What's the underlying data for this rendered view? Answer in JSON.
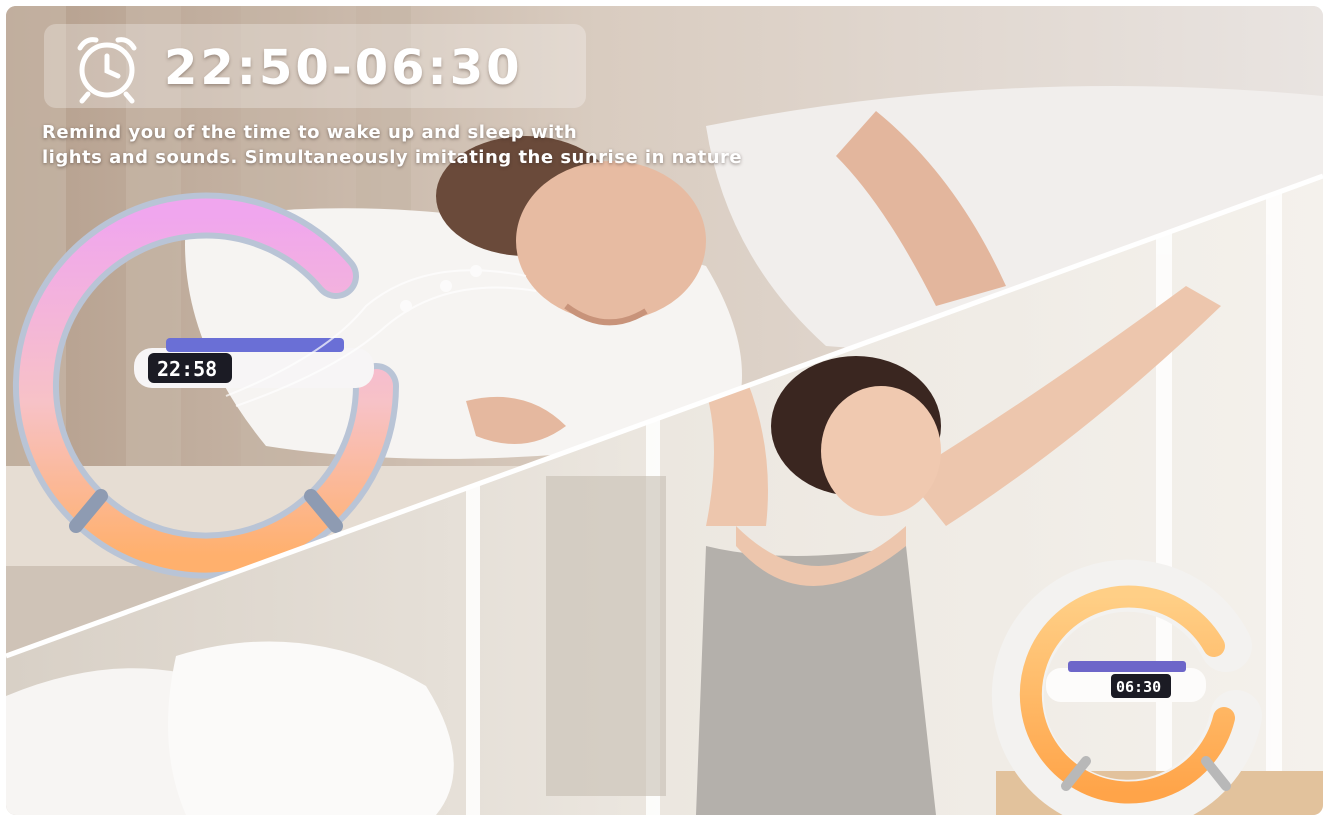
{
  "hero": {
    "time_range": "22:50-06:30",
    "caption_line1": "Remind you of the time to wake up and sleep with",
    "caption_line2": "lights and sounds. Simultaneously imitating the sunrise in nature",
    "alarm_icon": "alarm-clock-icon"
  },
  "devices": {
    "night_clock_display": "22:58",
    "morning_clock_display": "06:30"
  },
  "colors": {
    "night_ring_top": "#f3a8e8",
    "night_ring_bottom": "#ffb27a",
    "morning_ring": "#ffb968",
    "caption_text": "#ffffff"
  }
}
